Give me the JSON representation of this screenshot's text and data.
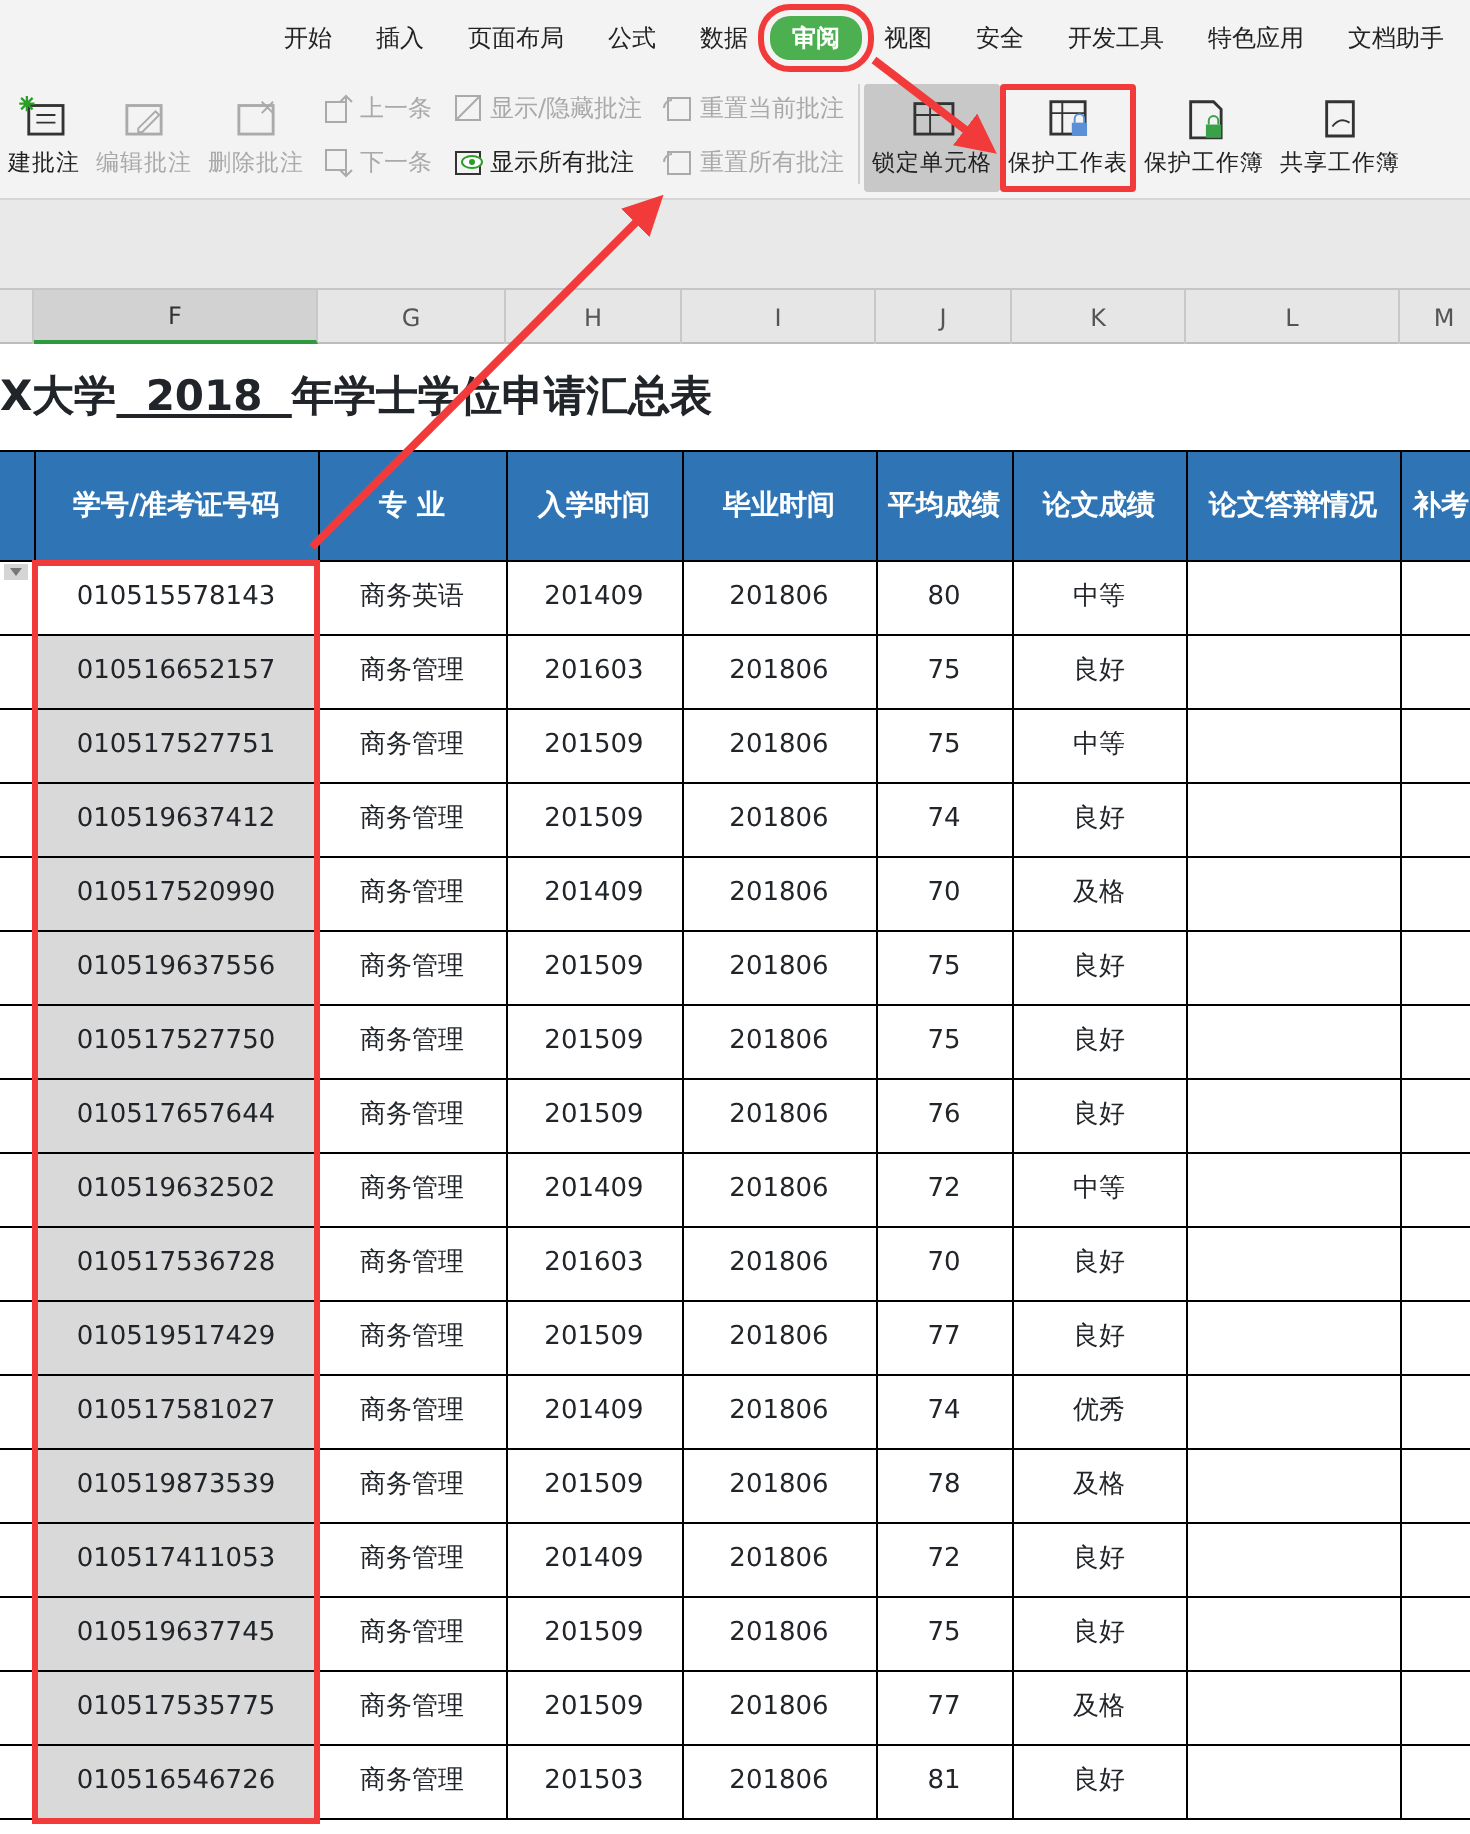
{
  "ribbon_tabs": [
    {
      "label": "开始",
      "selected": false,
      "highlighted": false
    },
    {
      "label": "插入",
      "selected": false,
      "highlighted": false
    },
    {
      "label": "页面布局",
      "selected": false,
      "highlighted": false
    },
    {
      "label": "公式",
      "selected": false,
      "highlighted": false
    },
    {
      "label": "数据",
      "selected": false,
      "highlighted": false
    },
    {
      "label": "审阅",
      "selected": true,
      "highlighted": true
    },
    {
      "label": "视图",
      "selected": false,
      "highlighted": false
    },
    {
      "label": "安全",
      "selected": false,
      "highlighted": false
    },
    {
      "label": "开发工具",
      "selected": false,
      "highlighted": false
    },
    {
      "label": "特色应用",
      "selected": false,
      "highlighted": false
    },
    {
      "label": "文档助手",
      "selected": false,
      "highlighted": false
    }
  ],
  "toolbar": [
    {
      "kind": "large",
      "label": "建批注",
      "disabled": false,
      "pressed": false,
      "highlighted": false
    },
    {
      "kind": "large",
      "label": "编辑批注",
      "disabled": true,
      "pressed": false,
      "highlighted": false
    },
    {
      "kind": "large",
      "label": "删除批注",
      "disabled": true,
      "pressed": false,
      "highlighted": false
    },
    {
      "kind": "stack",
      "items": [
        {
          "label": "上一条",
          "disabled": true
        },
        {
          "label": "下一条",
          "disabled": true
        }
      ]
    },
    {
      "kind": "stack",
      "items": [
        {
          "label": "显示/隐藏批注",
          "disabled": true
        },
        {
          "label": "显示所有批注",
          "disabled": false
        }
      ]
    },
    {
      "kind": "stack",
      "items": [
        {
          "label": "重置当前批注",
          "disabled": true
        },
        {
          "label": "重置所有批注",
          "disabled": true
        }
      ]
    },
    {
      "kind": "separator"
    },
    {
      "kind": "large",
      "label": "锁定单元格",
      "disabled": false,
      "pressed": true,
      "highlighted": false
    },
    {
      "kind": "large",
      "label": "保护工作表",
      "disabled": false,
      "pressed": false,
      "highlighted": true
    },
    {
      "kind": "large",
      "label": "保护工作簿",
      "disabled": false,
      "pressed": false,
      "highlighted": false
    },
    {
      "kind": "large",
      "label": "共享工作簿",
      "disabled": false,
      "pressed": false,
      "highlighted": false
    }
  ],
  "column_letters": [
    {
      "label": "F",
      "selected": true
    },
    {
      "label": "G",
      "selected": false
    },
    {
      "label": "H",
      "selected": false
    },
    {
      "label": "I",
      "selected": false
    },
    {
      "label": "J",
      "selected": false
    },
    {
      "label": "K",
      "selected": false
    },
    {
      "label": "L",
      "selected": false
    },
    {
      "label": "M",
      "selected": false
    }
  ],
  "sheet_title": {
    "prefix": "X大学",
    "year": "  2018  ",
    "suffix": "年学士学位申请汇总表"
  },
  "table": {
    "columns": [
      "学号/准考证号码",
      "专 业",
      "入学时间",
      "毕业时间",
      "平均成绩",
      "论文成绩",
      "论文答辩情况",
      "补考"
    ],
    "id_column_highlighted": true,
    "rows": [
      {
        "active": true,
        "cells": [
          "010515578143",
          "商务英语",
          "201409",
          "201806",
          "80",
          "中等",
          ""
        ]
      },
      {
        "active": false,
        "cells": [
          "010516652157",
          "商务管理",
          "201603",
          "201806",
          "75",
          "良好",
          ""
        ]
      },
      {
        "active": false,
        "cells": [
          "010517527751",
          "商务管理",
          "201509",
          "201806",
          "75",
          "中等",
          ""
        ]
      },
      {
        "active": false,
        "cells": [
          "010519637412",
          "商务管理",
          "201509",
          "201806",
          "74",
          "良好",
          ""
        ]
      },
      {
        "active": false,
        "cells": [
          "010517520990",
          "商务管理",
          "201409",
          "201806",
          "70",
          "及格",
          ""
        ]
      },
      {
        "active": false,
        "cells": [
          "010519637556",
          "商务管理",
          "201509",
          "201806",
          "75",
          "良好",
          ""
        ]
      },
      {
        "active": false,
        "cells": [
          "010517527750",
          "商务管理",
          "201509",
          "201806",
          "75",
          "良好",
          ""
        ]
      },
      {
        "active": false,
        "cells": [
          "010517657644",
          "商务管理",
          "201509",
          "201806",
          "76",
          "良好",
          ""
        ]
      },
      {
        "active": false,
        "cells": [
          "010519632502",
          "商务管理",
          "201409",
          "201806",
          "72",
          "中等",
          ""
        ]
      },
      {
        "active": false,
        "cells": [
          "010517536728",
          "商务管理",
          "201603",
          "201806",
          "70",
          "良好",
          ""
        ]
      },
      {
        "active": false,
        "cells": [
          "010519517429",
          "商务管理",
          "201509",
          "201806",
          "77",
          "良好",
          ""
        ]
      },
      {
        "active": false,
        "cells": [
          "010517581027",
          "商务管理",
          "201409",
          "201806",
          "74",
          "优秀",
          ""
        ]
      },
      {
        "active": false,
        "cells": [
          "010519873539",
          "商务管理",
          "201509",
          "201806",
          "78",
          "及格",
          ""
        ]
      },
      {
        "active": false,
        "cells": [
          "010517411053",
          "商务管理",
          "201409",
          "201806",
          "72",
          "良好",
          ""
        ]
      },
      {
        "active": false,
        "cells": [
          "010519637745",
          "商务管理",
          "201509",
          "201806",
          "75",
          "良好",
          ""
        ]
      },
      {
        "active": false,
        "cells": [
          "010517535775",
          "商务管理",
          "201509",
          "201806",
          "77",
          "及格",
          ""
        ]
      },
      {
        "active": false,
        "cells": [
          "010516546726",
          "商务管理",
          "201503",
          "201806",
          "81",
          "良好",
          ""
        ]
      }
    ]
  }
}
